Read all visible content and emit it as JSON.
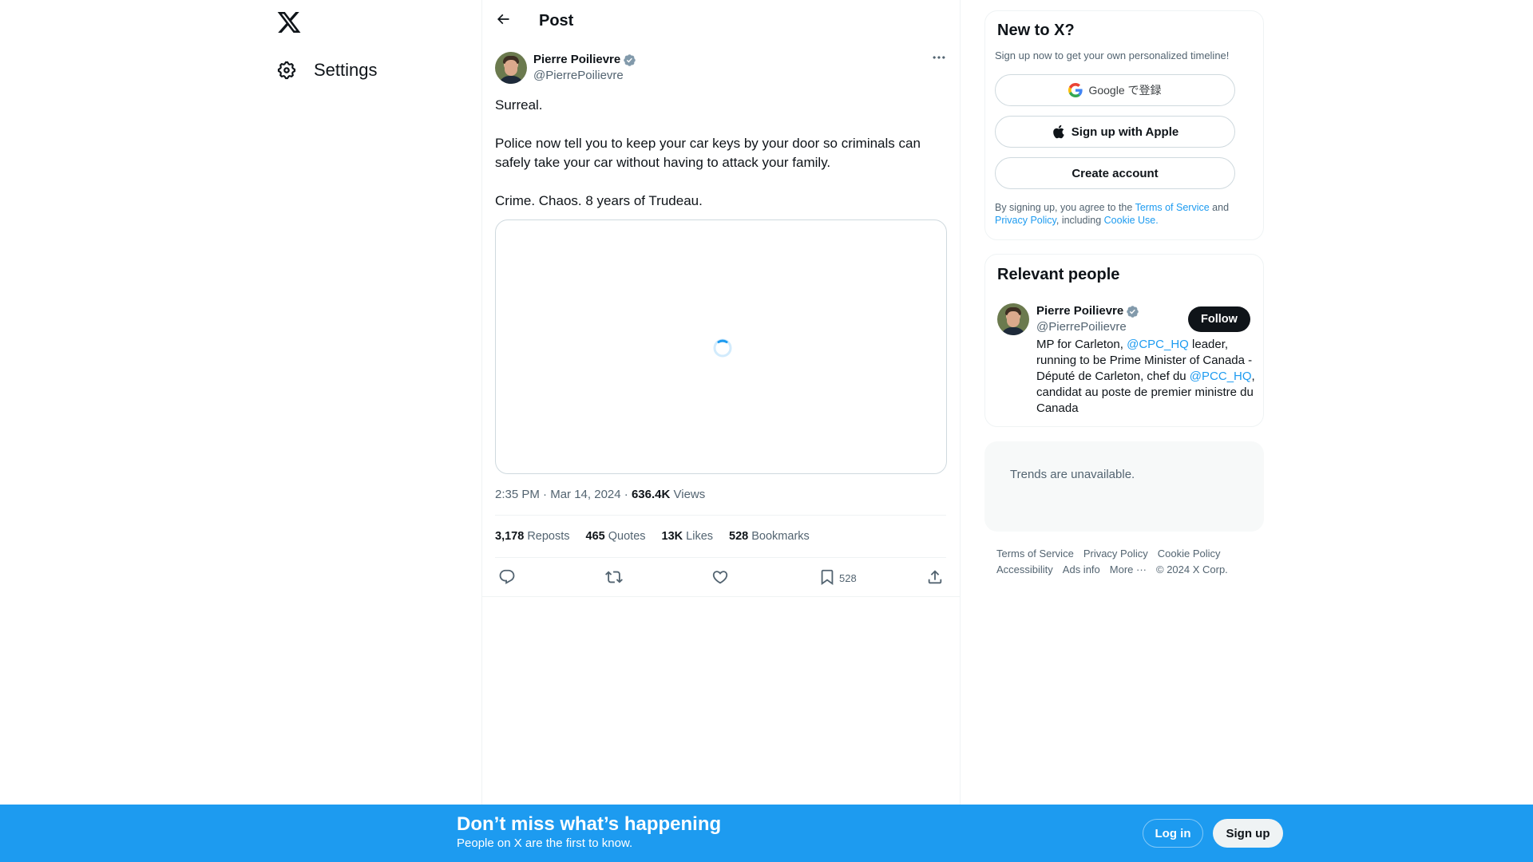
{
  "nav": {
    "logo_icon": "x-logo",
    "items": [
      {
        "label": "Settings",
        "icon": "gear-icon"
      }
    ]
  },
  "header": {
    "back_icon": "arrow-left-icon",
    "title": "Post"
  },
  "post": {
    "author": {
      "name": "Pierre Poilievre",
      "handle": "@PierrePoilievre",
      "verified": true
    },
    "more_icon": "more-horizontal-icon",
    "paragraphs": [
      "Surreal.",
      "Police now tell you to keep your car keys by your door so criminals can safely take your car without having to attack your family.",
      "Crime. Chaos. 8 years of Trudeau."
    ],
    "media": {
      "state": "loading"
    },
    "time": "2:35 PM",
    "date": "Mar 14, 2024",
    "separator": "·",
    "views_count": "636.4K",
    "views_label": "Views",
    "stats": [
      {
        "count": "3,178",
        "label": "Reposts"
      },
      {
        "count": "465",
        "label": "Quotes"
      },
      {
        "count": "13K",
        "label": "Likes"
      },
      {
        "count": "528",
        "label": "Bookmarks"
      }
    ],
    "actions": {
      "reply": {
        "icon": "reply-icon"
      },
      "repost": {
        "icon": "repost-icon"
      },
      "like": {
        "icon": "heart-icon"
      },
      "bookmark": {
        "icon": "bookmark-icon",
        "count": "528"
      },
      "share": {
        "icon": "share-icon"
      }
    }
  },
  "signup_card": {
    "title": "New to X?",
    "subtitle": "Sign up now to get your own personalized timeline!",
    "google_label": "Google で登録",
    "apple_label": "Sign up with Apple",
    "create_label": "Create account",
    "terms_prefix": "By signing up, you agree to the ",
    "terms_link": "Terms of Service",
    "terms_and": " and ",
    "privacy_link": "Privacy Policy",
    "terms_including": ", including ",
    "cookie_link": "Cookie Use."
  },
  "relevant_people": {
    "title": "Relevant people",
    "person": {
      "name": "Pierre Poilievre",
      "handle": "@PierrePoilievre",
      "follow_label": "Follow",
      "bio_1": "MP for Carleton, ",
      "bio_mention_1": "@CPC_HQ",
      "bio_2": " leader, running to be Prime Minister of Canada - Député de Carleton, chef du ",
      "bio_mention_2": "@PCC_HQ",
      "bio_3": ", candidat au poste de premier ministre du Canada"
    }
  },
  "trends": {
    "message": "Trends are unavailable."
  },
  "footer": {
    "links": [
      "Terms of Service",
      "Privacy Policy",
      "Cookie Policy",
      "Accessibility",
      "Ads info",
      "More ···"
    ],
    "copyright": "© 2024 X Corp."
  },
  "bottom_bar": {
    "title": "Don’t miss what’s happening",
    "subtitle": "People on X are the first to know.",
    "login_label": "Log in",
    "signup_label": "Sign up"
  },
  "colors": {
    "accent": "#1d9bf0",
    "text_primary": "#0f1419",
    "text_secondary": "#536471",
    "border": "#eff3f4"
  }
}
